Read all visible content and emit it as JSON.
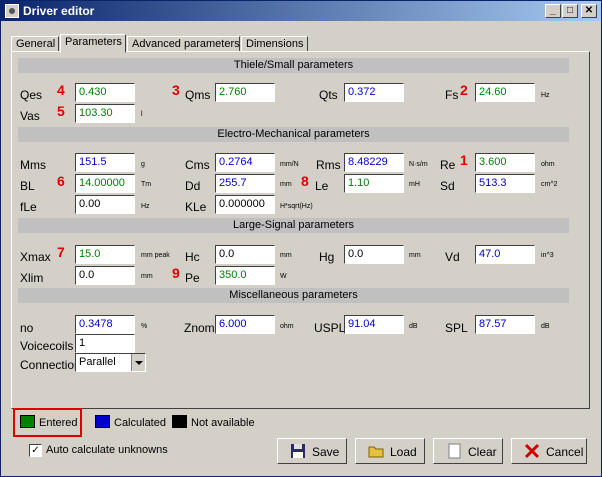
{
  "window": {
    "title": "Driver editor"
  },
  "tabs": [
    "General",
    "Parameters",
    "Advanced parameters",
    "Dimensions"
  ],
  "sections": {
    "ts": "Thiele/Small parameters",
    "em": "Electro-Mechanical parameters",
    "ls": "Large-Signal parameters",
    "misc": "Miscellaneous parameters"
  },
  "fields": {
    "qes": {
      "label": "Qes",
      "value": "0.430",
      "unit": ""
    },
    "qms": {
      "label": "Qms",
      "value": "2.760",
      "unit": ""
    },
    "qts": {
      "label": "Qts",
      "value": "0.372",
      "unit": ""
    },
    "fs": {
      "label": "Fs",
      "value": "24.60",
      "unit": "Hz"
    },
    "vas": {
      "label": "Vas",
      "value": "103.30",
      "unit": "l"
    },
    "mms": {
      "label": "Mms",
      "value": "151.5",
      "unit": "g"
    },
    "cms": {
      "label": "Cms",
      "value": "0.2764",
      "unit": "mm/N"
    },
    "rms": {
      "label": "Rms",
      "value": "8.48229",
      "unit": "N·s/m"
    },
    "re": {
      "label": "Re",
      "value": "3.600",
      "unit": "ohm"
    },
    "bl": {
      "label": "BL",
      "value": "14.00000",
      "unit": "Tm"
    },
    "dd": {
      "label": "Dd",
      "value": "255.7",
      "unit": "mm"
    },
    "le": {
      "label": "Le",
      "value": "1.10",
      "unit": "mH"
    },
    "sd": {
      "label": "Sd",
      "value": "513.3",
      "unit": "cm^2"
    },
    "fle": {
      "label": "fLe",
      "value": "0.00",
      "unit": "Hz"
    },
    "kle": {
      "label": "KLe",
      "value": "0.000000",
      "unit": "H*sqrt(Hz)"
    },
    "xmax": {
      "label": "Xmax",
      "value": "15.0",
      "unit": "mm peak"
    },
    "hc": {
      "label": "Hc",
      "value": "0.0",
      "unit": "mm"
    },
    "hg": {
      "label": "Hg",
      "value": "0.0",
      "unit": "mm"
    },
    "vd": {
      "label": "Vd",
      "value": "47.0",
      "unit": "in^3"
    },
    "xlim": {
      "label": "Xlim",
      "value": "0.0",
      "unit": "mm"
    },
    "pe": {
      "label": "Pe",
      "value": "350.0",
      "unit": "W"
    },
    "no": {
      "label": "no",
      "value": "0.3478",
      "unit": "%"
    },
    "znom": {
      "label": "Znom",
      "value": "6.000",
      "unit": "ohm"
    },
    "uspl": {
      "label": "USPL",
      "value": "91.04",
      "unit": "dB"
    },
    "spl": {
      "label": "SPL",
      "value": "87.57",
      "unit": "dB"
    },
    "voicecoils": {
      "label": "Voicecoils",
      "value": "1"
    },
    "connection": {
      "label": "Connection",
      "value": "Parallel"
    }
  },
  "annotations": [
    "1",
    "2",
    "3",
    "4",
    "5",
    "6",
    "7",
    "8",
    "9"
  ],
  "legend": {
    "entered": "Entered",
    "calculated": "Calculated",
    "not_available": "Not available"
  },
  "colors": {
    "entered": "#008000",
    "calculated": "#0000cc",
    "not_available": "#000000",
    "annotation": "#e00000"
  },
  "auto_calc": {
    "label": "Auto calculate unknowns",
    "checked": true
  },
  "buttons": {
    "save": "Save",
    "load": "Load",
    "clear": "Clear",
    "cancel": "Cancel"
  }
}
